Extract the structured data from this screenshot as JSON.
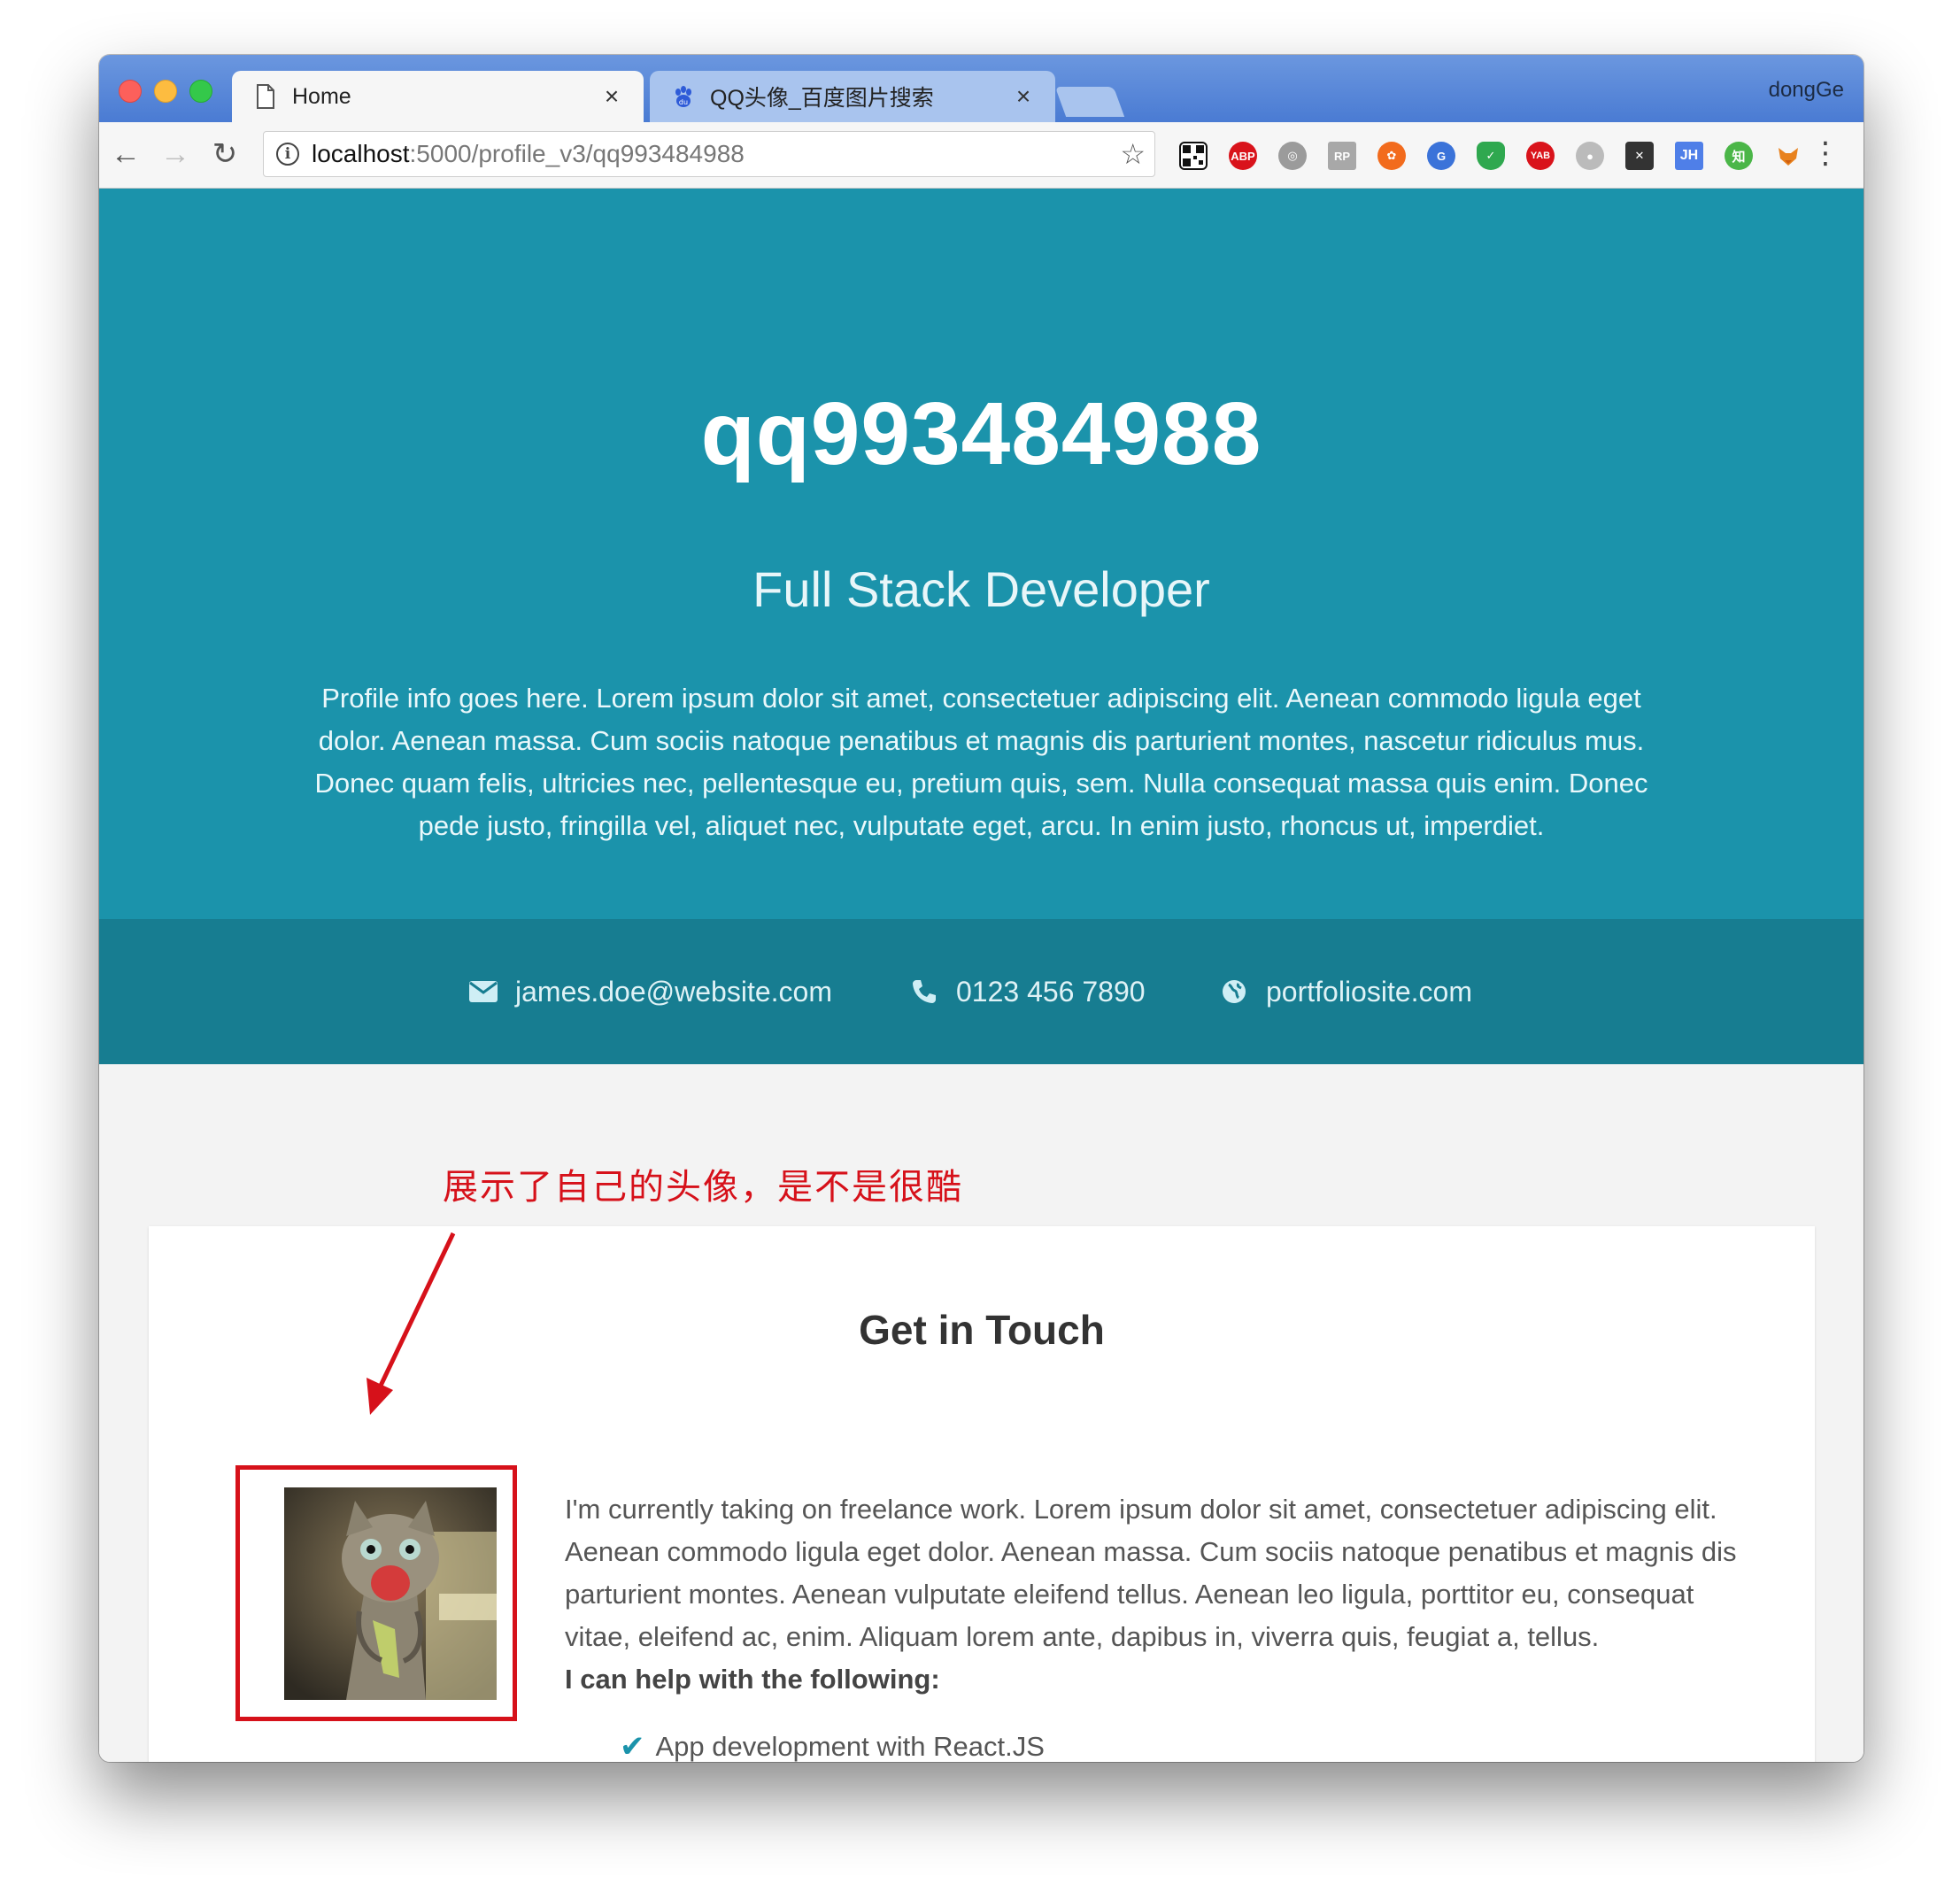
{
  "browser": {
    "tabs": [
      {
        "title": "Home",
        "active": true,
        "icon": "document-icon"
      },
      {
        "title": "QQ头像_百度图片搜索",
        "active": false,
        "icon": "baidu-paw-icon"
      }
    ],
    "profile_name": "dongGe",
    "address": {
      "host": "localhost",
      "path": ":5000/profile_v3/qq993484988"
    },
    "extensions": [
      "qr-code-icon",
      "adblock-plus-icon",
      "globe-icon",
      "rp-icon",
      "orange-gear-icon",
      "translate-icon",
      "shield-check-icon",
      "yab-icon",
      "ghost-icon",
      "x-icon",
      "jh-icon",
      "zhihu-icon",
      "fox-icon"
    ]
  },
  "profile": {
    "name": "qq993484988",
    "title": "Full Stack Developer",
    "description": "Profile info goes here. Lorem ipsum dolor sit amet, consectetuer adipiscing elit. Aenean commodo ligula eget dolor. Aenean massa. Cum sociis natoque penatibus et magnis dis parturient montes, nascetur ridiculus mus. Donec quam felis, ultricies nec, pellentesque eu, pretium quis, sem. Nulla consequat massa quis enim. Donec pede justo, fringilla vel, aliquet nec, vulputate eget, arcu. In enim justo, rhoncus ut, imperdiet."
  },
  "contact": {
    "email": "james.doe@website.com",
    "phone": "0123 456 7890",
    "website": "portfoliosite.com"
  },
  "annotation": "展示了自己的头像，是不是很酷",
  "section": {
    "heading": "Get in Touch",
    "text": "I'm currently taking on freelance work. Lorem ipsum dolor sit amet, consectetuer adipiscing elit. Aenean commodo ligula eget dolor. Aenean massa. Cum sociis natoque penatibus et magnis dis parturient montes. Aenean vulputate eleifend tellus. Aenean leo ligula, porttitor eu, consequat vitae, eleifend ac, enim. Aliquam lorem ante, dapibus in, viverra quis, feugiat a, tellus.",
    "subheading": "I can help with the following:",
    "help_items": [
      "App development with React.JS"
    ]
  },
  "colors": {
    "hero": "#1b93ab",
    "contact_bar": "#177d91",
    "annotation": "#d6111a"
  }
}
